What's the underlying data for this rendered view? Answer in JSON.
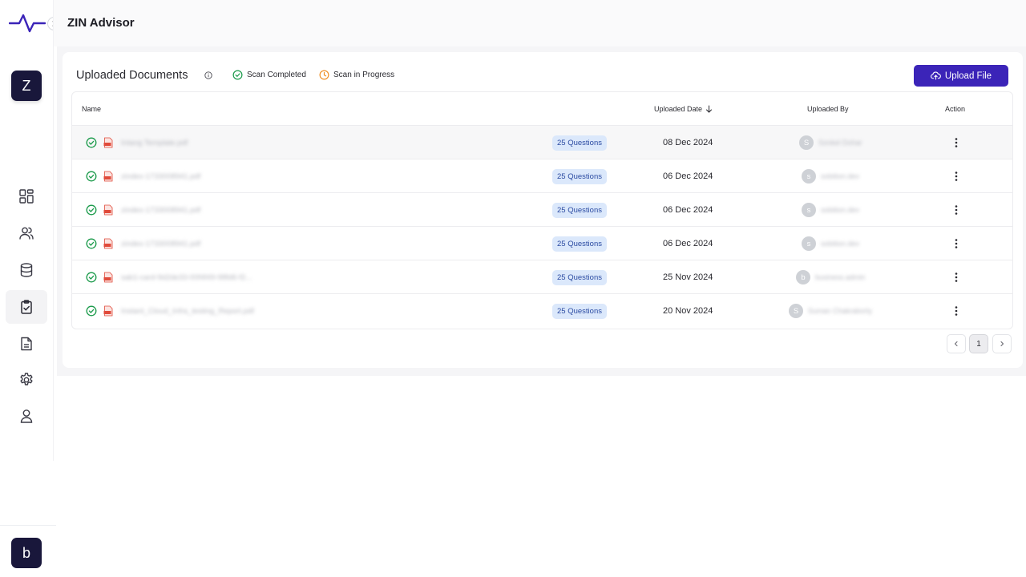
{
  "app": {
    "title": "ZIN Advisor"
  },
  "sidebar": {
    "top_avatar": "Z",
    "bottom_avatar": "b",
    "items": [
      {
        "name": "dashboard",
        "icon": "grid-icon"
      },
      {
        "name": "users",
        "icon": "users-icon"
      },
      {
        "name": "database",
        "icon": "database-icon"
      },
      {
        "name": "assessments",
        "icon": "clipboard-check-icon",
        "active": true
      },
      {
        "name": "documents",
        "icon": "file-text-icon"
      },
      {
        "name": "settings",
        "icon": "gear-icon"
      },
      {
        "name": "profile",
        "icon": "user-icon"
      }
    ]
  },
  "page": {
    "title": "Uploaded Documents",
    "legend": {
      "completed": "Scan Completed",
      "in_progress": "Scan in Progress"
    },
    "upload_label": "Upload File"
  },
  "colors": {
    "accent": "#3b24b8",
    "completed": "#1a9a4a",
    "in_progress": "#f0922b",
    "badge_bg": "#dbe8fb"
  },
  "table": {
    "headers": {
      "name": "Name",
      "date": "Uploaded Date",
      "by": "Uploaded By",
      "action": "Action"
    },
    "rows": [
      {
        "file": "Intang Template.pdf",
        "questions": "25 Questions",
        "date": "08 Dec 2024",
        "initial": "S",
        "user": "Sonkel Dohar"
      },
      {
        "file": "zindex-1733008941.pdf",
        "questions": "25 Questions",
        "date": "06 Dec 2024",
        "initial": "s",
        "user": "sobition.dev"
      },
      {
        "file": "zindex-1733008941.pdf",
        "questions": "25 Questions",
        "date": "06 Dec 2024",
        "initial": "s",
        "user": "sobition.dev"
      },
      {
        "file": "zindex-1733008941.pdf",
        "questions": "25 Questions",
        "date": "06 Dec 2024",
        "initial": "s",
        "user": "sobition.dev"
      },
      {
        "file": "sab1-card-9d2de33-00f4f49-98fd6-f2...",
        "questions": "25 Questions",
        "date": "25 Nov 2024",
        "initial": "b",
        "user": "business.admin"
      },
      {
        "file": "Instant_Cloud_Infra_testing_Report.pdf",
        "questions": "25 Questions",
        "date": "20 Nov 2024",
        "initial": "S",
        "user": "Suman Chakraborty"
      }
    ]
  },
  "pagination": {
    "current": "1"
  }
}
